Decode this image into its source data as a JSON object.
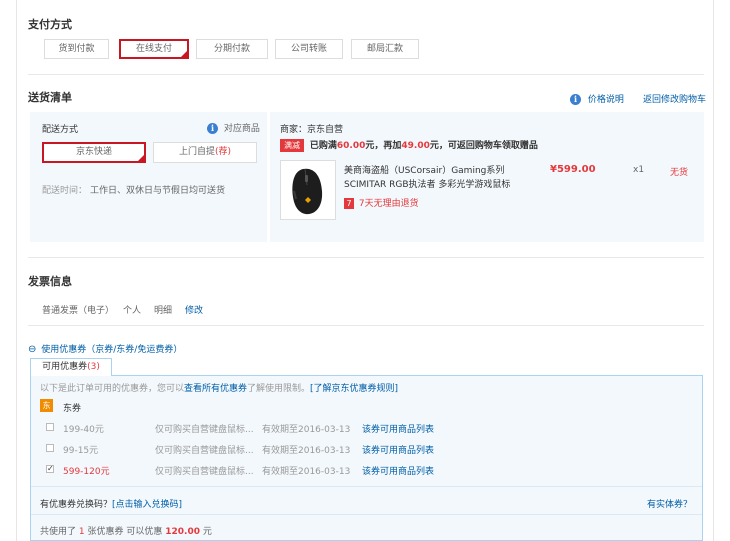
{
  "payment": {
    "title": "支付方式",
    "options": [
      "货到付款",
      "在线支付",
      "分期付款",
      "公司转账",
      "邮局汇款"
    ],
    "selected_index": 1
  },
  "delivery": {
    "title": "送货清单",
    "price_note": "价格说明",
    "back_to_cart": "返回修改购物车",
    "method_label": "配送方式",
    "match_goods": "对应商品",
    "shipping_options": [
      "京东快递",
      "上门自提"
    ],
    "pickup_badge": "荐",
    "time_label": "配送时间：",
    "time_value": "工作日、双休日与节假日均可送货",
    "merchant_label": "商家：",
    "merchant_name": "京东自营",
    "promo_tag": "满减",
    "promo_prefix": "已购满",
    "promo_amount1": "60.00",
    "promo_mid": "元，再加",
    "promo_amount2": "49.00",
    "promo_suffix": "元，可返回购物车领取赠品",
    "product_name_line1": "美商海盗船（USCorsair）Gaming系列",
    "product_name_line2": "SCIMITAR RGB执法者 多彩光学游戏鼠标",
    "return_badge": "7",
    "return_text": "7天无理由退货",
    "price": "¥599.00",
    "qty": "x1",
    "stock": "无货"
  },
  "invoice": {
    "title": "发票信息",
    "type": "普通发票（电子）",
    "holder": "个人",
    "content": "明细",
    "modify": "修改"
  },
  "coupons": {
    "toggle_icon": "⊖",
    "toggle_label": "使用优惠券（京券/东券/免运费券）",
    "tab_label": "可用优惠券",
    "tab_count": "(3)",
    "notice_prefix": "以下是此订单可用的优惠券，您可以",
    "notice_link1": "查看所有优惠券",
    "notice_mid": "了解使用限制。",
    "notice_link2": "[了解京东优惠券规则]",
    "dong_badge": "东",
    "dong_label": "东券",
    "items": [
      {
        "name": "199-40元",
        "desc": "仅可购买自营键盘鼠标...",
        "expiry": "有效期至2016-03-13",
        "link": "该券可用商品列表",
        "checked": false
      },
      {
        "name": "99-15元",
        "desc": "仅可购买自营键盘鼠标...",
        "expiry": "有效期至2016-03-13",
        "link": "该券可用商品列表",
        "checked": false
      },
      {
        "name": "599-120元",
        "desc": "仅可购买自营键盘鼠标...",
        "expiry": "有效期至2016-03-13",
        "link": "该券可用商品列表",
        "checked": true
      }
    ],
    "exchange_question": "有优惠券兑换码？",
    "exchange_link": "[点击输入兑换码]",
    "physical_link": "有实体券？",
    "summary_prefix": "共使用了",
    "summary_count": "1",
    "summary_mid": "张优惠券  可以优惠",
    "summary_amount": "120.00",
    "summary_suffix": "元"
  },
  "colors": {
    "accent": "#c81623",
    "price": "#e4393c",
    "link": "#005ea7",
    "panel": "#f3f8fc"
  }
}
